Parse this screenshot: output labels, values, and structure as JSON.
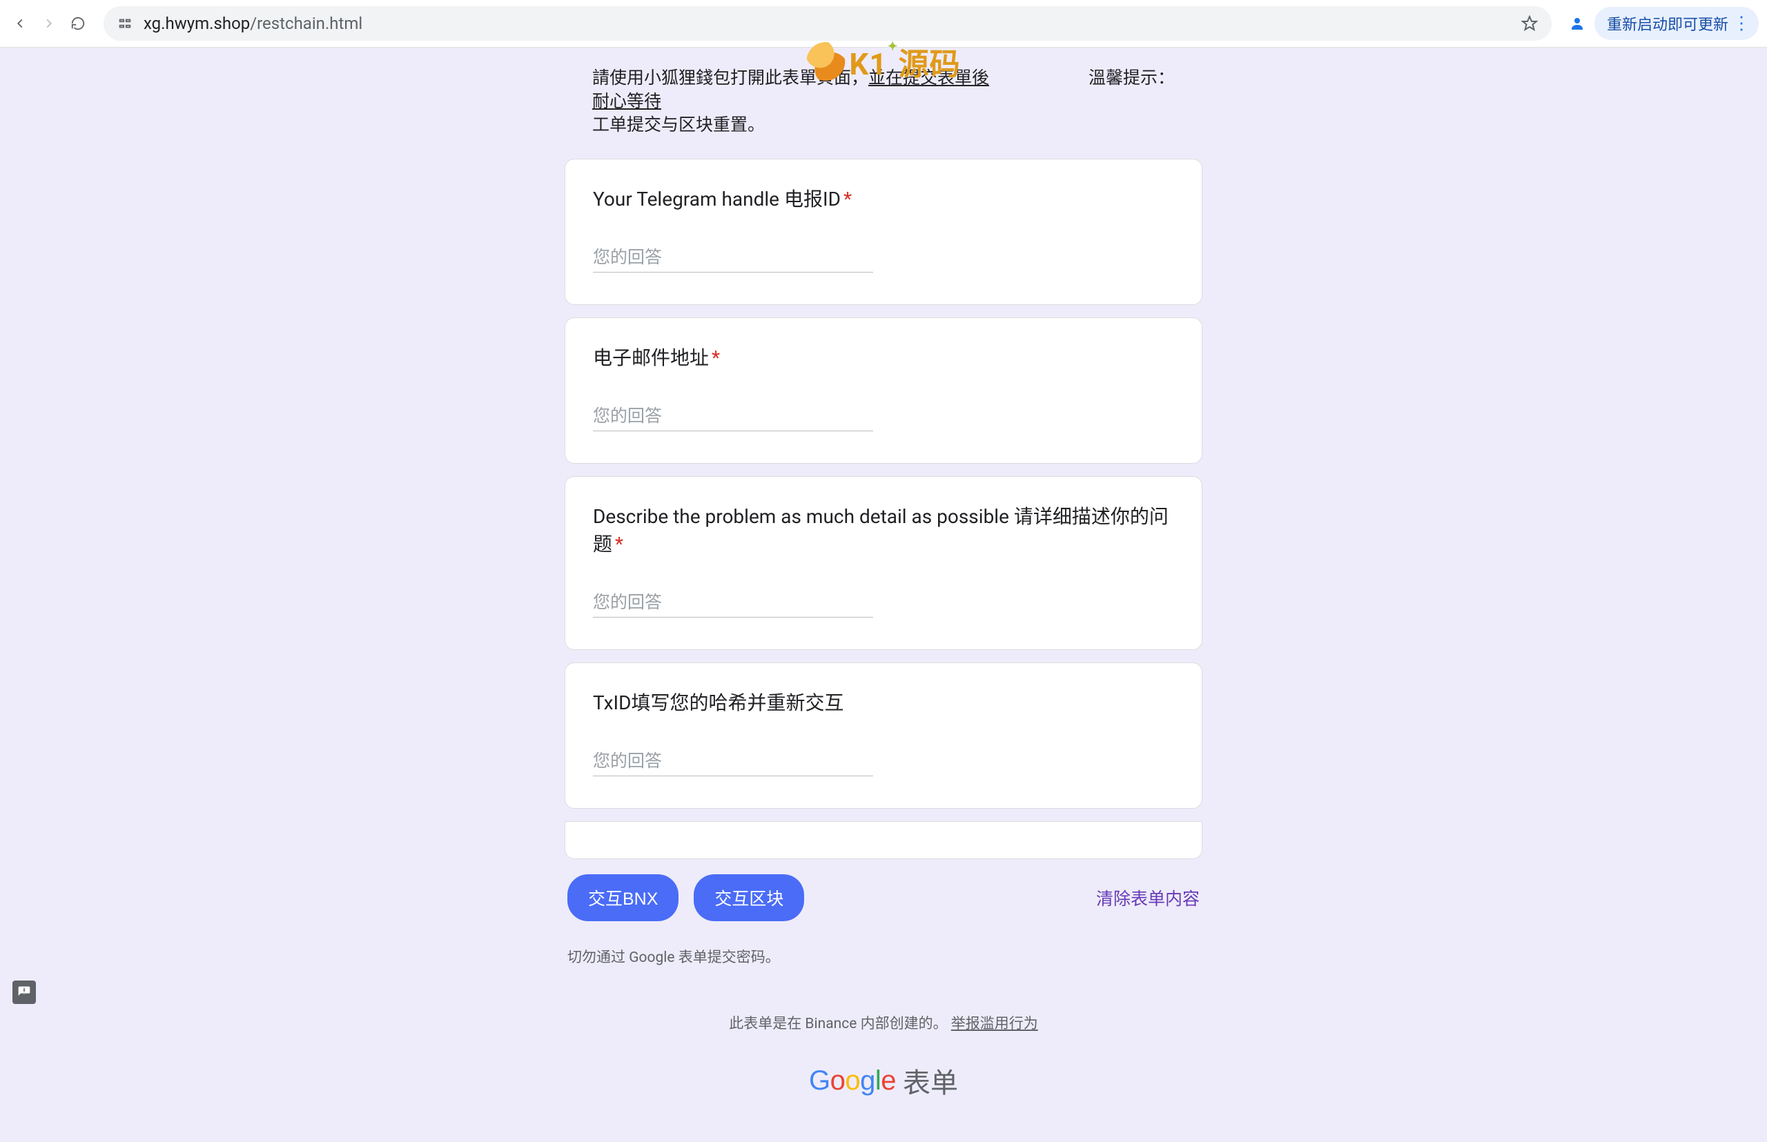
{
  "browser": {
    "url_host": "xg.hwym.shop",
    "url_path": "/restchain.html",
    "update_label": "重新启动即可更新"
  },
  "watermark": {
    "text": "K1 源码"
  },
  "intro": {
    "left_line1_a": "請使用小狐狸錢包打開此表單頁面，",
    "left_line1_b": "並在提交表單後耐心等待",
    "left_line2": "工单提交与区块重置。",
    "right": "溫馨提示："
  },
  "questions": [
    {
      "label": "Your Telegram handle 电报ID",
      "required": true,
      "placeholder": "您的回答"
    },
    {
      "label": "电子邮件地址",
      "required": true,
      "placeholder": "您的回答"
    },
    {
      "label": "Describe the problem as much detail as possible 请详细描述你的问题",
      "required": true,
      "placeholder": "您的回答"
    },
    {
      "label": "TxID填写您的哈希并重新交互",
      "required": false,
      "placeholder": "您的回答"
    }
  ],
  "actions": {
    "btn1": "交互BNX",
    "btn2": "交互区块",
    "clear": "清除表单内容"
  },
  "warning": "切勿通过 Google 表单提交密码。",
  "footer": {
    "creator_note": "此表单是在 Binance 内部创建的。 ",
    "report_abuse": "举报滥用行为"
  },
  "google_forms_suffix": "表单"
}
